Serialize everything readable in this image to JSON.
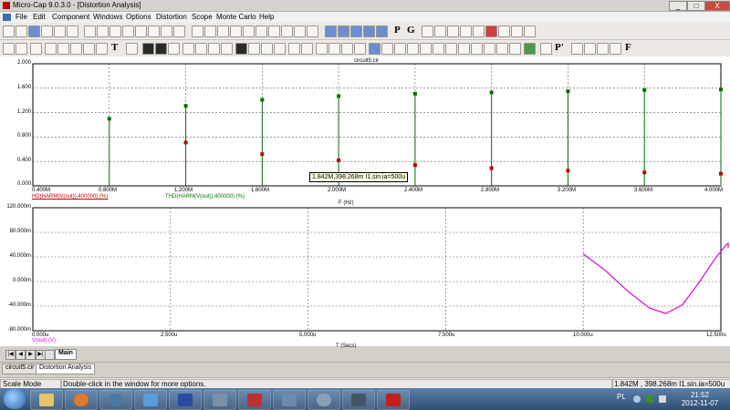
{
  "window": {
    "title": "Micro-Cap 9.0.3.0 - [Distortion Analysis]",
    "min": "_",
    "max": "□",
    "close": "X"
  },
  "menu": [
    "File",
    "Edit",
    "Component",
    "Windows",
    "Options",
    "Distortion",
    "Scope",
    "Monte Carlo",
    "Help"
  ],
  "toolbar": {
    "text_p": "P",
    "text_g": "G",
    "text_t": "T",
    "text_f": "F",
    "text_p2": "P'"
  },
  "top_plot": {
    "title": "circuit5.cir",
    "y_ticks": [
      "2.000",
      "1.600",
      "1.200",
      "0.800",
      "0.400",
      "0.000"
    ],
    "x_ticks": [
      "0.400M",
      "0.800M",
      "1.200M",
      "1.600M",
      "2.000M",
      "2.400M",
      "2.800M",
      "3.200M",
      "3.600M",
      "4.000M"
    ],
    "expr_hd": "HD(HARM(V(out)),400000) (%)",
    "expr_thd": "THD(HARM(V(out)),400000) (%)",
    "xlabel": "F (Hz)"
  },
  "bottom_plot": {
    "y_ticks": [
      "120.000m",
      "80.000m",
      "40.000m",
      "0.000m",
      "-40.000m",
      "-80.000m"
    ],
    "x_ticks": [
      "0.000u",
      "2.500u",
      "5.000u",
      "7.500u",
      "10.000u",
      "12.500u"
    ],
    "expr": "V(out) (V)",
    "xlabel": "T (Secs)"
  },
  "tooltip": "1.842M,398.268m I1.sin.ia=500u",
  "page_tab": "Main",
  "doc_tabs": [
    "circuit5.cir",
    "Distortion Analysis"
  ],
  "status": {
    "mode": "Scale Mode",
    "hint": "Double-click in the window for more options.",
    "readout": "1.842M , 398.268m  I1.sin.ia=500u"
  },
  "taskbar": {
    "lang": "PL",
    "time": "21:52",
    "date": "2012-11-07"
  },
  "colors": {
    "hd": "#c00000",
    "thd": "#007000",
    "vout": "#e000e0",
    "grid": "#5a5a5a"
  },
  "chart_data": [
    {
      "type": "scatter",
      "title": "circuit5.cir",
      "xlabel": "F (Hz)",
      "ylabel": "",
      "xlim": [
        0.4,
        4.0
      ],
      "ylim": [
        0.0,
        2.0
      ],
      "x_unit": "MHz",
      "series": [
        {
          "name": "THD(HARM(V(out)),400000) (%)",
          "color": "#007000",
          "x": [
            0.8,
            1.2,
            1.6,
            2.0,
            2.4,
            2.8,
            3.2,
            3.6,
            4.0
          ],
          "y": [
            1.1,
            1.31,
            1.41,
            1.47,
            1.51,
            1.53,
            1.55,
            1.57,
            1.58
          ]
        },
        {
          "name": "HD(HARM(V(out)),400000) (%)",
          "color": "#c00000",
          "x": [
            1.2,
            1.6,
            2.0,
            2.4,
            2.8,
            3.2,
            3.6,
            4.0
          ],
          "y": [
            0.71,
            0.52,
            0.42,
            0.34,
            0.29,
            0.25,
            0.22,
            0.2
          ]
        }
      ]
    },
    {
      "type": "line",
      "xlabel": "T (Secs)",
      "ylabel": "",
      "xlim": [
        0,
        12.5
      ],
      "ylim": [
        -80,
        120
      ],
      "x_unit": "us",
      "y_unit": "mV",
      "series": [
        {
          "name": "V(out) (V)",
          "color": "#e000e0",
          "x_start": 10.0,
          "x_end": 12.5,
          "points": [
            [
              10.0,
              45
            ],
            [
              10.4,
              18
            ],
            [
              10.8,
              -15
            ],
            [
              11.2,
              -43
            ],
            [
              11.5,
              -52
            ],
            [
              11.8,
              -38
            ],
            [
              12.1,
              -2
            ],
            [
              12.4,
              38
            ],
            [
              12.6,
              60
            ],
            [
              12.8,
              62
            ],
            [
              13.0,
              55
            ]
          ]
        }
      ]
    }
  ]
}
